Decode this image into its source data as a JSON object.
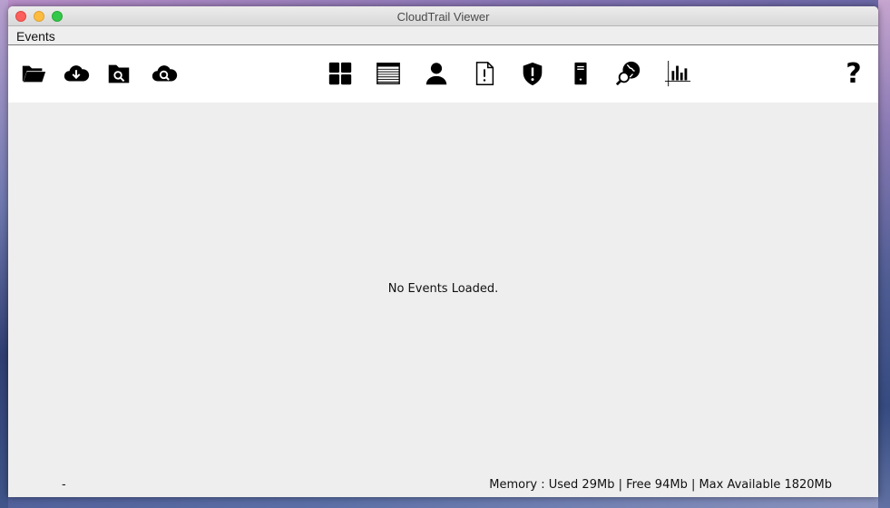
{
  "window": {
    "title": "CloudTrail Viewer"
  },
  "menu": {
    "items": [
      {
        "label": "Events"
      }
    ]
  },
  "toolbar": {
    "left_tools": [
      "folder-open-icon",
      "cloud-download-icon",
      "folder-search-icon",
      "cloud-search-icon"
    ],
    "center_tools": [
      "dashboard-grid-icon",
      "table-list-icon",
      "user-icon",
      "file-alert-icon",
      "security-shield-icon",
      "server-icon",
      "globe-search-icon",
      "chart-bars-icon"
    ],
    "help_label": "?"
  },
  "content": {
    "empty_message": "No Events Loaded."
  },
  "status": {
    "left": "-",
    "memory": "Memory : Used 29Mb | Free 94Mb | Max Available 1820Mb"
  },
  "colors": {
    "close": "#fc605c",
    "minimize": "#fdbc40",
    "maximize": "#34c84a",
    "icon": "#000000"
  }
}
